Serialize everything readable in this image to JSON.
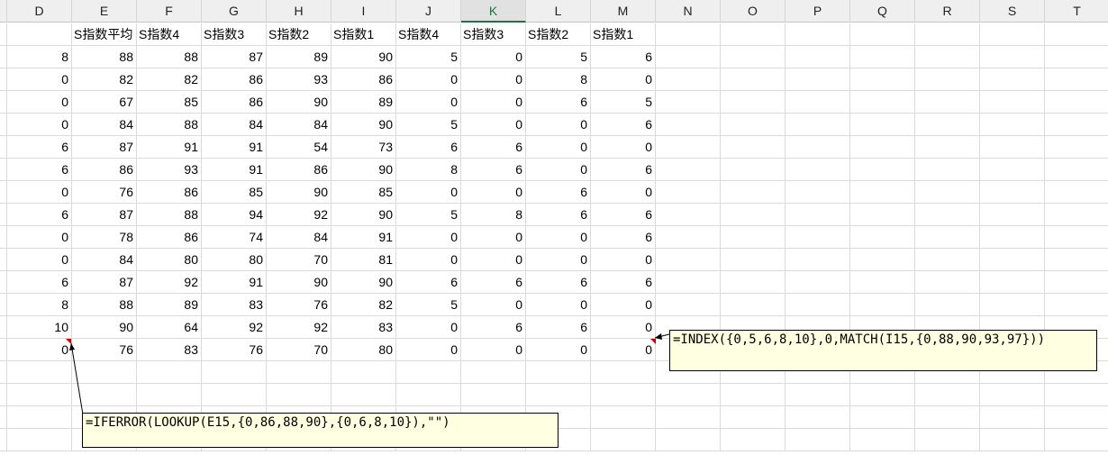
{
  "columns": [
    "D",
    "E",
    "F",
    "G",
    "H",
    "I",
    "J",
    "K",
    "L",
    "M",
    "N",
    "O",
    "P",
    "Q",
    "R",
    "S",
    "T"
  ],
  "active_column": "K",
  "header_row": [
    "",
    "S指数平均",
    "S指数4",
    "S指数3",
    "S指数2",
    "S指数1",
    "S指数4",
    "S指数3",
    "S指数2",
    "S指数1"
  ],
  "rows": [
    [
      8,
      88,
      88,
      87,
      89,
      90,
      5,
      0,
      5,
      6
    ],
    [
      0,
      82,
      82,
      86,
      93,
      86,
      0,
      0,
      8,
      0
    ],
    [
      0,
      67,
      85,
      86,
      90,
      89,
      0,
      0,
      6,
      5
    ],
    [
      0,
      84,
      88,
      84,
      84,
      90,
      5,
      0,
      0,
      6
    ],
    [
      6,
      87,
      91,
      91,
      54,
      73,
      6,
      6,
      0,
      0
    ],
    [
      6,
      86,
      93,
      91,
      86,
      90,
      8,
      6,
      0,
      6
    ],
    [
      0,
      76,
      86,
      85,
      90,
      85,
      0,
      0,
      6,
      0
    ],
    [
      6,
      87,
      88,
      94,
      92,
      90,
      5,
      8,
      6,
      6
    ],
    [
      0,
      78,
      86,
      74,
      84,
      91,
      0,
      0,
      0,
      6
    ],
    [
      0,
      84,
      80,
      80,
      70,
      81,
      0,
      0,
      0,
      0
    ],
    [
      6,
      87,
      92,
      91,
      90,
      90,
      6,
      6,
      6,
      6
    ],
    [
      8,
      88,
      89,
      83,
      76,
      82,
      5,
      0,
      0,
      0
    ],
    [
      10,
      90,
      64,
      92,
      92,
      83,
      0,
      6,
      6,
      0
    ],
    [
      0,
      76,
      83,
      76,
      70,
      80,
      0,
      0,
      0,
      0
    ]
  ],
  "comments": {
    "m_formula": "=INDEX({0,5,6,8,10},0,MATCH(I15,{0,88,90,93,97}))",
    "d_formula": "=IFERROR(LOOKUP(E15,{0,86,88,90},{0,6,8,10}),\"\")"
  },
  "colors": {
    "comment_bg": "#ffffe1",
    "note_indicator": "#c00000",
    "active_header": "#217346"
  }
}
